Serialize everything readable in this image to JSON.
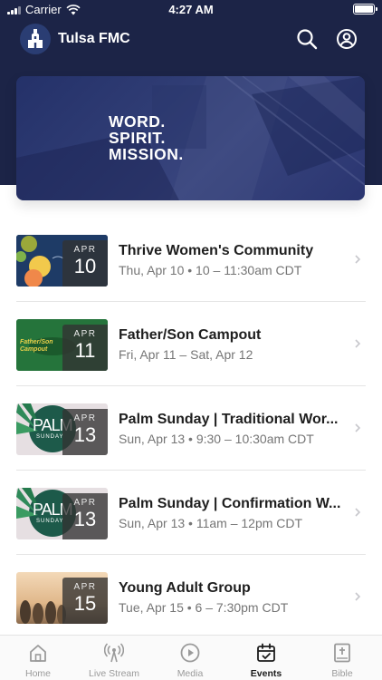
{
  "status_bar": {
    "carrier": "Carrier",
    "time": "4:27 AM"
  },
  "header": {
    "title": "Tulsa FMC"
  },
  "hero": {
    "line1": "WORD.",
    "line2": "SPIRIT.",
    "line3": "MISSION."
  },
  "events": [
    {
      "month": "APR",
      "day": "10",
      "title": "Thrive Women's Community",
      "subtitle": "Thu, Apr 10 • 10 – 11:30am CDT"
    },
    {
      "month": "APR",
      "day": "11",
      "title": "Father/Son Campout",
      "subtitle": "Fri, Apr 11 – Sat, Apr 12",
      "thumb_text": "Father/Son Campout"
    },
    {
      "month": "APR",
      "day": "13",
      "title": "Palm Sunday | Traditional Wor...",
      "subtitle": "Sun, Apr 13 • 9:30 – 10:30am CDT",
      "thumb_text": "PALM",
      "thumb_sub": "SUNDAY"
    },
    {
      "month": "APR",
      "day": "13",
      "title": "Palm Sunday | Confirmation W...",
      "subtitle": "Sun, Apr 13 • 11am – 12pm CDT",
      "thumb_text": "PALM",
      "thumb_sub": "SUNDAY"
    },
    {
      "month": "APR",
      "day": "15",
      "title": "Young Adult Group",
      "subtitle": "Tue, Apr 15 • 6 – 7:30pm CDT"
    }
  ],
  "tabs": [
    {
      "label": "Home",
      "icon": "home-icon"
    },
    {
      "label": "Live Stream",
      "icon": "live-stream-icon"
    },
    {
      "label": "Media",
      "icon": "play-icon"
    },
    {
      "label": "Events",
      "icon": "calendar-icon",
      "active": true
    },
    {
      "label": "Bible",
      "icon": "bible-icon"
    }
  ],
  "colors": {
    "header_bg": "#1c2447",
    "active_tab": "#1c1c1c",
    "inactive_tab": "#9a9a9a",
    "subtitle": "#757575"
  }
}
